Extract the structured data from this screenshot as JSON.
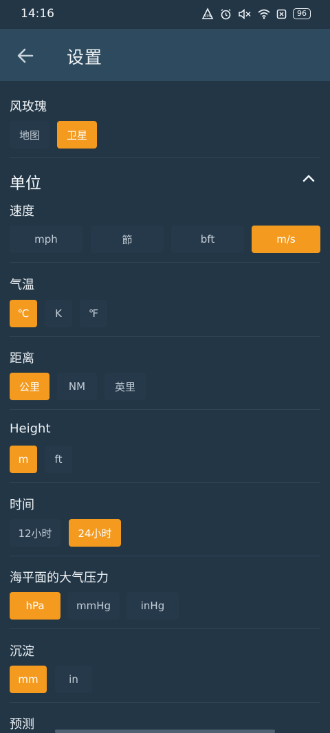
{
  "status": {
    "time": "14:16",
    "battery": "96",
    "icons": [
      "vpn-icon",
      "alarm-icon",
      "mute-icon",
      "wifi-icon",
      "sim-off-icon",
      "battery-icon"
    ]
  },
  "header": {
    "title": "设置",
    "back_icon": "arrow-left-icon"
  },
  "windrose": {
    "label": "风玫瑰",
    "options": [
      "地图",
      "卫星"
    ],
    "selected": "卫星"
  },
  "units": {
    "heading": "单位",
    "speed": {
      "label": "速度",
      "options": [
        "mph",
        "節",
        "bft",
        "m/s"
      ],
      "selected": "m/s"
    },
    "temp": {
      "label": "气温",
      "options": [
        "℃",
        "K",
        "℉"
      ],
      "selected": "℃"
    },
    "distance": {
      "label": "距离",
      "options": [
        "公里",
        "NM",
        "英里"
      ],
      "selected": "公里"
    },
    "height": {
      "label": "Height",
      "options": [
        "m",
        "ft"
      ],
      "selected": "m"
    },
    "time": {
      "label": "时间",
      "options": [
        "12小时",
        "24小时"
      ],
      "selected": "24小时"
    },
    "pressure": {
      "label": "海平面的大气压力",
      "options": [
        "hPa",
        "mmHg",
        "inHg"
      ],
      "selected": "hPa"
    },
    "precip": {
      "label": "沉淀",
      "options": [
        "mm",
        "in"
      ],
      "selected": "mm"
    },
    "forecast": {
      "label": "预测"
    }
  },
  "colors": {
    "accent": "#f39a1f",
    "background": "#223646",
    "appbar": "#2d4a5e",
    "chip": "#26394a"
  }
}
